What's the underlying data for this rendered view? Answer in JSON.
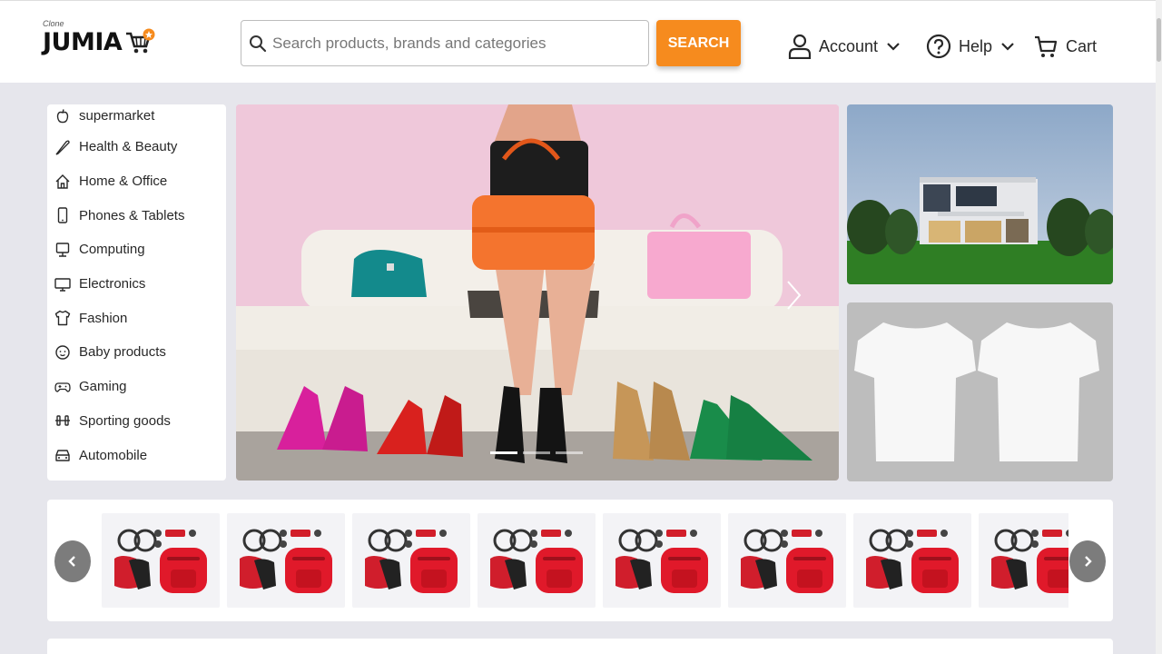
{
  "header": {
    "logo_tag": "Clone",
    "logo_text": "JUMIA",
    "search_placeholder": "Search products, brands and categories",
    "search_button": "SEARCH",
    "account_label": "Account",
    "help_label": "Help",
    "cart_label": "Cart"
  },
  "sidebar": {
    "categories": [
      {
        "label": "supermarket",
        "icon": "apple-icon"
      },
      {
        "label": "Health & Beauty",
        "icon": "brush-icon"
      },
      {
        "label": "Home & Office",
        "icon": "home-icon"
      },
      {
        "label": "Phones & Tablets",
        "icon": "phone-icon"
      },
      {
        "label": "Computing",
        "icon": "computer-icon"
      },
      {
        "label": "Electronics",
        "icon": "monitor-icon"
      },
      {
        "label": "Fashion",
        "icon": "shirt-icon"
      },
      {
        "label": "Baby products",
        "icon": "baby-icon"
      },
      {
        "label": "Gaming",
        "icon": "gamepad-icon"
      },
      {
        "label": "Sporting goods",
        "icon": "dumbbell-icon"
      },
      {
        "label": "Automobile",
        "icon": "car-icon"
      }
    ]
  },
  "hero": {
    "slide_count": 3,
    "active_slide": 1
  },
  "strip": {
    "thumb_count": 8
  },
  "colors": {
    "accent": "#f68b1e",
    "background": "#e6e6ec"
  }
}
